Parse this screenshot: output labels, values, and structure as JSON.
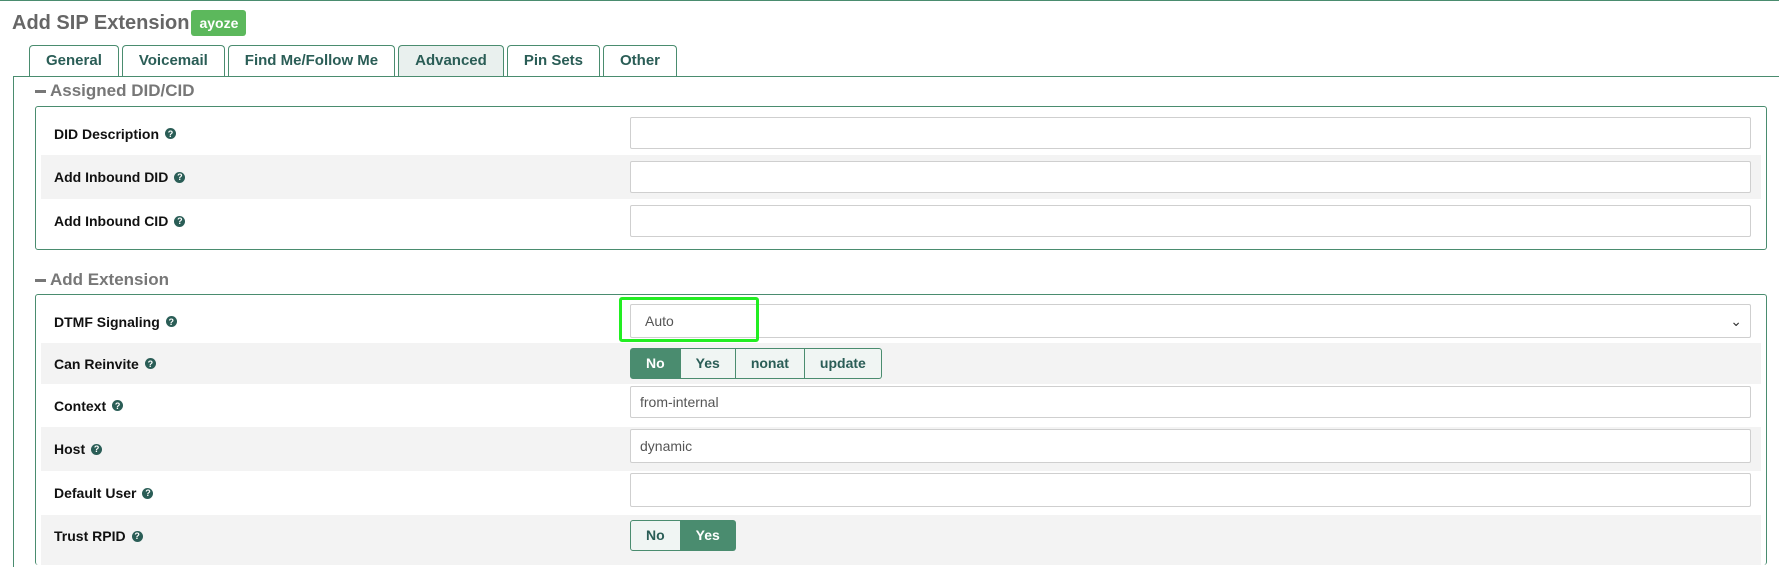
{
  "header": {
    "title": "Add SIP Extension",
    "user_badge": "ayoze"
  },
  "tabs": [
    {
      "label": "General"
    },
    {
      "label": "Voicemail"
    },
    {
      "label": "Find Me/Follow Me"
    },
    {
      "label": "Advanced",
      "active": true
    },
    {
      "label": "Pin Sets"
    },
    {
      "label": "Other"
    }
  ],
  "sections": {
    "did": {
      "title": "Assigned DID/CID",
      "fields": {
        "did_description": {
          "label": "DID Description",
          "value": ""
        },
        "inbound_did": {
          "label": "Add Inbound DID",
          "value": ""
        },
        "inbound_cid": {
          "label": "Add Inbound CID",
          "value": ""
        }
      }
    },
    "extension": {
      "title": "Add Extension",
      "dtmf": {
        "label": "DTMF Signaling",
        "selected": "Auto"
      },
      "reinvite": {
        "label": "Can Reinvite",
        "options": [
          "No",
          "Yes",
          "nonat",
          "update"
        ],
        "selected": "No"
      },
      "context": {
        "label": "Context",
        "value": "from-internal"
      },
      "host": {
        "label": "Host",
        "value": "dynamic"
      },
      "default_user": {
        "label": "Default User",
        "value": ""
      },
      "trust_rpid": {
        "label": "Trust RPID",
        "options": [
          "No",
          "Yes"
        ],
        "selected": "Yes"
      }
    }
  },
  "icons": {
    "help": "question-circle-icon",
    "collapse": "minus-icon",
    "dropdown": "chevron-down-icon"
  },
  "colors": {
    "accent": "#4a8c6f",
    "badge": "#5cb85c",
    "highlight": "#22ee22"
  },
  "glyphs": {
    "help": "?",
    "chevron": "⌄"
  }
}
